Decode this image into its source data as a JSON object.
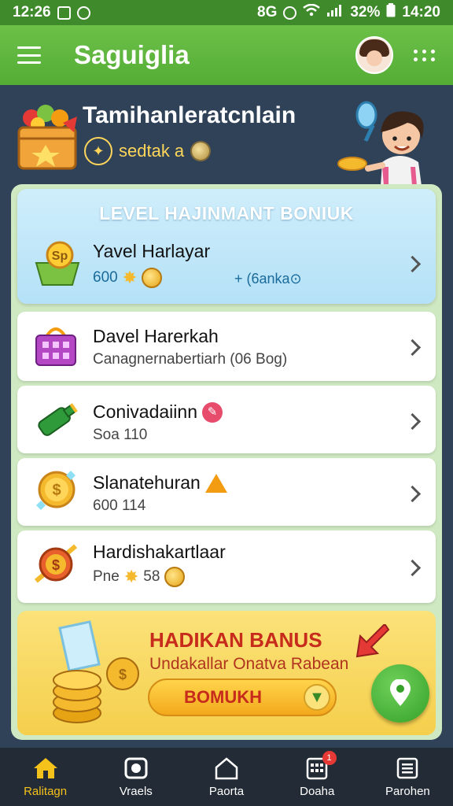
{
  "status_bar": {
    "time_left": "12:26",
    "network": "8G",
    "battery": "32%",
    "time_right": "14:20"
  },
  "app_bar": {
    "title": "Saguiglia"
  },
  "hero": {
    "title": "Tamihanleratcnlain",
    "subtitle": "sedtak a"
  },
  "level_card": {
    "header": "LEVEL HAJINMANT BONIUK",
    "title": "Yavel Harlayar",
    "value": "600",
    "extra": "+ (6anka⊙"
  },
  "list": [
    {
      "title": "Davel Harerkah",
      "subtitle": "Canagnernabertiarh (06 Bog)",
      "icon": "basket-icon"
    },
    {
      "title": "Conivadaiinn",
      "subtitle": "Soa 110",
      "icon": "bottle-icon"
    },
    {
      "title": "Slanatehuran",
      "subtitle": "600 114",
      "icon": "coin-icon"
    },
    {
      "title": "Hardishakartlaar",
      "subtitle": "Pne",
      "subtitle_value": "58",
      "icon": "medal-icon"
    }
  ],
  "bonus": {
    "title": "HADIKAN BANUS",
    "subtitle": "Undakallar Onatva Rabean",
    "button": "BOMUKH"
  },
  "bottom_nav": [
    {
      "label": "Ralitagn",
      "icon": "home-icon",
      "active": true
    },
    {
      "label": "Vraels",
      "icon": "camera-icon",
      "active": false
    },
    {
      "label": "Paorta",
      "icon": "house-outline-icon",
      "active": false
    },
    {
      "label": "Doaha",
      "icon": "calendar-icon",
      "active": false,
      "badge": "1"
    },
    {
      "label": "Parohen",
      "icon": "list-icon",
      "active": false
    }
  ],
  "colors": {
    "app_bar": "#5cb63c",
    "background": "#2f4258",
    "accent_gold": "#f5c21b",
    "bonus_red": "#c62b1b"
  }
}
